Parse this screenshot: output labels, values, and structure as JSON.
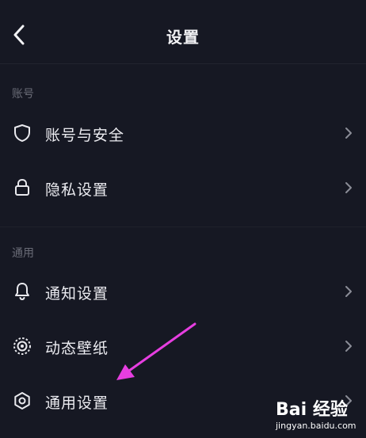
{
  "header": {
    "title": "设置"
  },
  "sections": [
    {
      "label": "账号",
      "items": [
        {
          "label": "账号与安全",
          "icon": "shield-icon"
        },
        {
          "label": "隐私设置",
          "icon": "lock-icon"
        }
      ]
    },
    {
      "label": "通用",
      "items": [
        {
          "label": "通知设置",
          "icon": "bell-icon"
        },
        {
          "label": "动态壁纸",
          "icon": "wallpaper-icon"
        },
        {
          "label": "通用设置",
          "icon": "gear-icon"
        }
      ]
    }
  ],
  "watermark": {
    "brand": "Bai 经验",
    "url": "jingyan.baidu.com"
  },
  "colors": {
    "background": "#161823",
    "text": "#ececf1",
    "muted": "#6a6c77",
    "annotation_arrow": "#e63ee0"
  }
}
